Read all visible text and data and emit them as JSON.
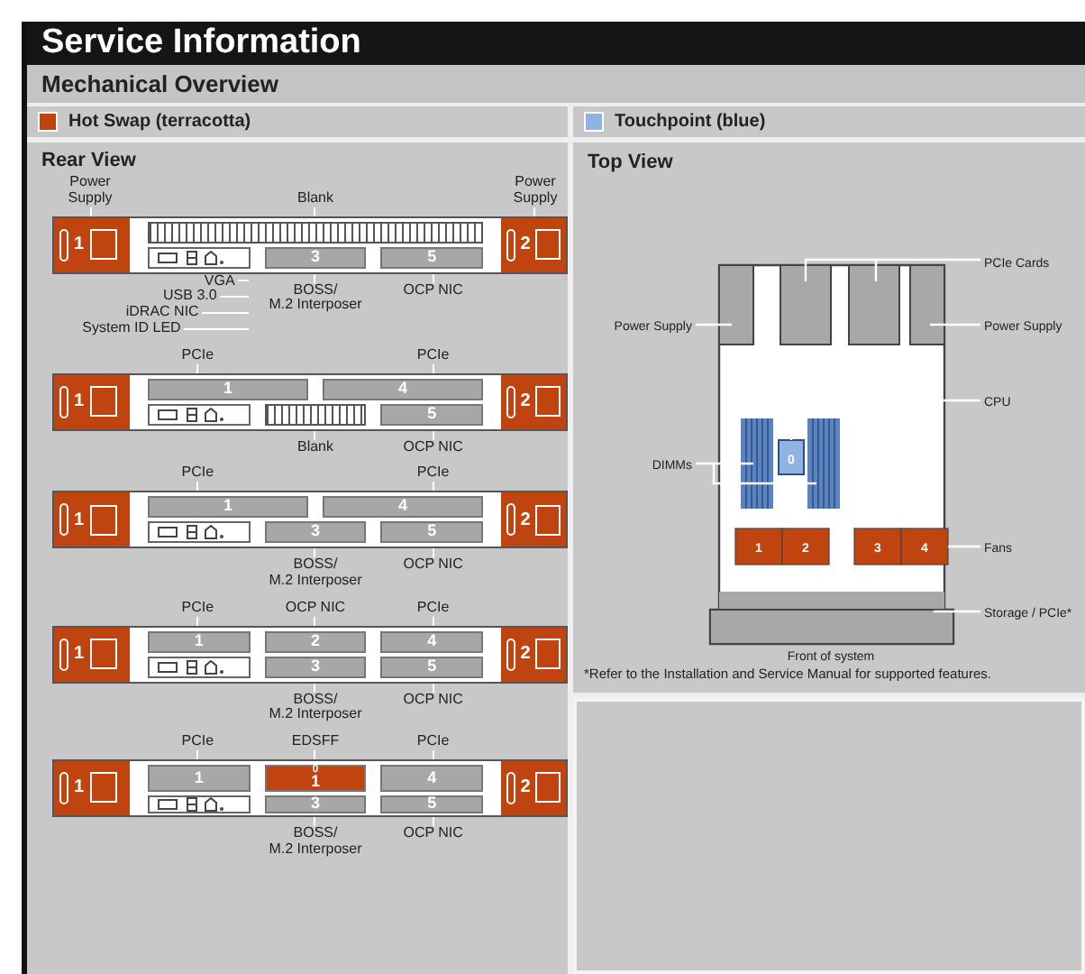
{
  "title": "Service Information",
  "subtitle": "Mechanical Overview",
  "legend": [
    {
      "label": "Hot Swap (terracotta)",
      "color": "#c0440f"
    },
    {
      "label": "Touchpoint (blue)",
      "color": "#8fb4e3"
    }
  ],
  "rear_view": {
    "title": "Rear View",
    "configs": [
      {
        "psus": [
          "1",
          "2"
        ],
        "top_labels": {
          "psu_left": "Power Supply",
          "all": "Blank",
          "psu_right": "Power Supply"
        },
        "top_row": [
          {
            "kind": "grill"
          }
        ],
        "bottom_row": [
          {
            "kind": "ports"
          },
          {
            "kind": "card",
            "label": "3"
          },
          {
            "kind": "card",
            "label": "5"
          }
        ],
        "port_callouts": [
          "VGA",
          "USB 3.0",
          "iDRAC NIC",
          "System ID LED"
        ],
        "bottom_labels": {
          "middle": "BOSS/\nM.2 Interposer",
          "right": "OCP NIC"
        }
      },
      {
        "psus": [
          "1",
          "2"
        ],
        "top_labels": {
          "left": "PCIe",
          "right": "PCIe"
        },
        "top_row": [
          {
            "kind": "card",
            "label": "1"
          },
          {
            "kind": "card",
            "label": "4"
          }
        ],
        "bottom_row": [
          {
            "kind": "ports"
          },
          {
            "kind": "grill"
          },
          {
            "kind": "card",
            "label": "5"
          }
        ],
        "bottom_labels": {
          "middle": "Blank",
          "right": "OCP NIC"
        }
      },
      {
        "psus": [
          "1",
          "2"
        ],
        "top_labels": {
          "left": "PCIe",
          "right": "PCIe"
        },
        "top_row": [
          {
            "kind": "card",
            "label": "1"
          },
          {
            "kind": "card",
            "label": "4"
          }
        ],
        "bottom_row": [
          {
            "kind": "ports"
          },
          {
            "kind": "card",
            "label": "3"
          },
          {
            "kind": "card",
            "label": "5"
          }
        ],
        "bottom_labels": {
          "middle": "BOSS/\nM.2 Interposer",
          "right": "OCP NIC"
        }
      },
      {
        "psus": [
          "1",
          "2"
        ],
        "top_labels": {
          "left": "PCIe",
          "middle": "OCP NIC",
          "right": "PCIe"
        },
        "top_row": [
          {
            "kind": "card",
            "label": "1"
          },
          {
            "kind": "card",
            "label": "2"
          },
          {
            "kind": "card",
            "label": "4"
          }
        ],
        "bottom_row": [
          {
            "kind": "ports"
          },
          {
            "kind": "card",
            "label": "3"
          },
          {
            "kind": "card",
            "label": "5"
          }
        ],
        "bottom_labels": {
          "middle": "BOSS/\nM.2 Interposer",
          "right": "OCP NIC"
        }
      },
      {
        "psus": [
          "1",
          "2"
        ],
        "top_labels": {
          "left": "PCIe",
          "middle": "EDSFF",
          "right": "PCIe"
        },
        "top_row": [
          {
            "kind": "card",
            "label": "1"
          },
          {
            "kind": "edsff",
            "sub_label": "0",
            "label": "1"
          },
          {
            "kind": "card",
            "label": "4"
          }
        ],
        "bottom_row": [
          {
            "kind": "ports"
          },
          {
            "kind": "card",
            "label": "3"
          },
          {
            "kind": "card",
            "label": "5"
          }
        ],
        "bottom_labels": {
          "middle": "BOSS/\nM.2 Interposer",
          "right": "OCP NIC"
        }
      }
    ]
  },
  "top_view": {
    "title": "Top View",
    "pcie_label": "PCIe Cards",
    "psu_left_label": "Power Supply",
    "psu_right_label": "Power Supply",
    "cpu_label": "CPU",
    "cpu_number": "0",
    "dimm_label": "DIMMs",
    "fans": [
      "1",
      "2",
      "3",
      "4"
    ],
    "fans_label": "Fans",
    "storage_label": "Storage / PCIe*",
    "front_label": "Front of system",
    "footnote": "*Refer to the Installation and Service Manual for supported features."
  }
}
